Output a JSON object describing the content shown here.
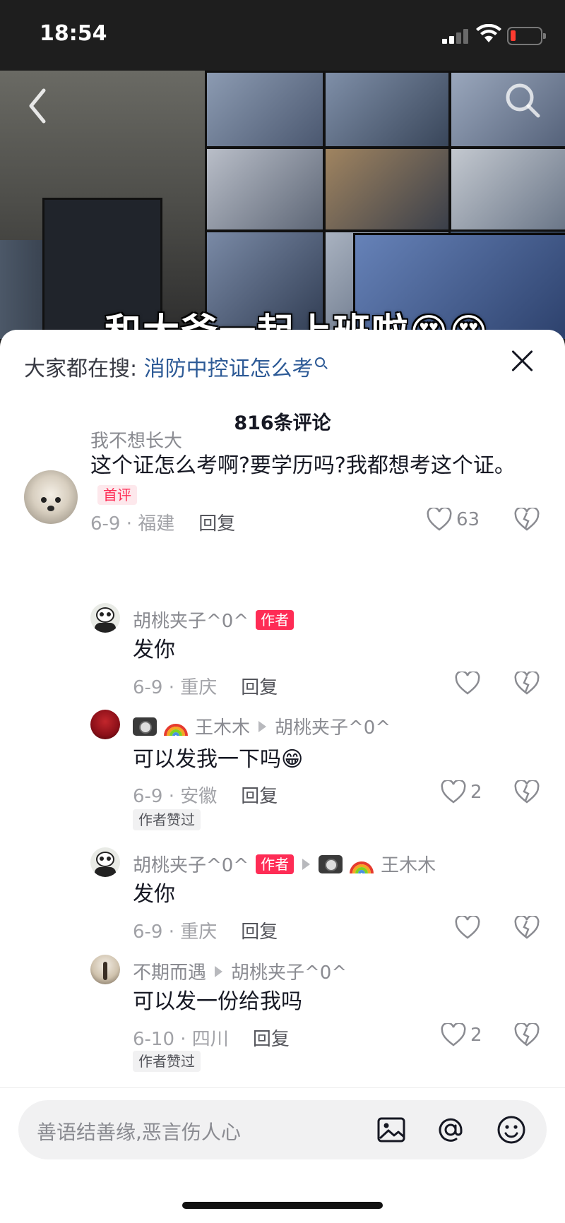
{
  "status_bar": {
    "time": "18:54"
  },
  "video": {
    "caption": "和大爷一起上班啦😍😍"
  },
  "sheet": {
    "hot_search_label": "大家都在搜:",
    "hot_search_keyword": "消防中控证怎么考",
    "comment_count": "816条评论"
  },
  "comments": [
    {
      "user": "我不想长大",
      "text": "这个证怎么考啊?要学历吗?我都想考这个证。",
      "badge": "首评",
      "meta": "6-9 · 福建",
      "reply_label": "回复",
      "likes": "63"
    },
    {
      "user": "胡桃夹子^0^",
      "author_tag": "作者",
      "text": "发你",
      "meta": "6-9 · 重庆",
      "reply_label": "回复",
      "likes": ""
    },
    {
      "user": "王木木",
      "reply_to": "胡桃夹子^0^",
      "text": "可以发我一下吗😁",
      "meta": "6-9 · 安徽",
      "reply_label": "回复",
      "likes": "2",
      "author_liked": "作者赞过"
    },
    {
      "user": "胡桃夹子^0^",
      "author_tag": "作者",
      "reply_to": "王木木",
      "text": "发你",
      "meta": "6-9 · 重庆",
      "reply_label": "回复",
      "likes": ""
    },
    {
      "user": "不期而遇",
      "reply_to": "胡桃夹子^0^",
      "text": "可以发一份给我吗",
      "meta": "6-10 · 四川",
      "reply_label": "回复",
      "likes": "2",
      "author_liked": "作者赞过"
    }
  ],
  "input_bar": {
    "placeholder": "善语结善缘,恶言伤人心"
  },
  "colors": {
    "accent": "#fe2c55",
    "link": "#2d5a96",
    "muted": "#8a8b91"
  }
}
